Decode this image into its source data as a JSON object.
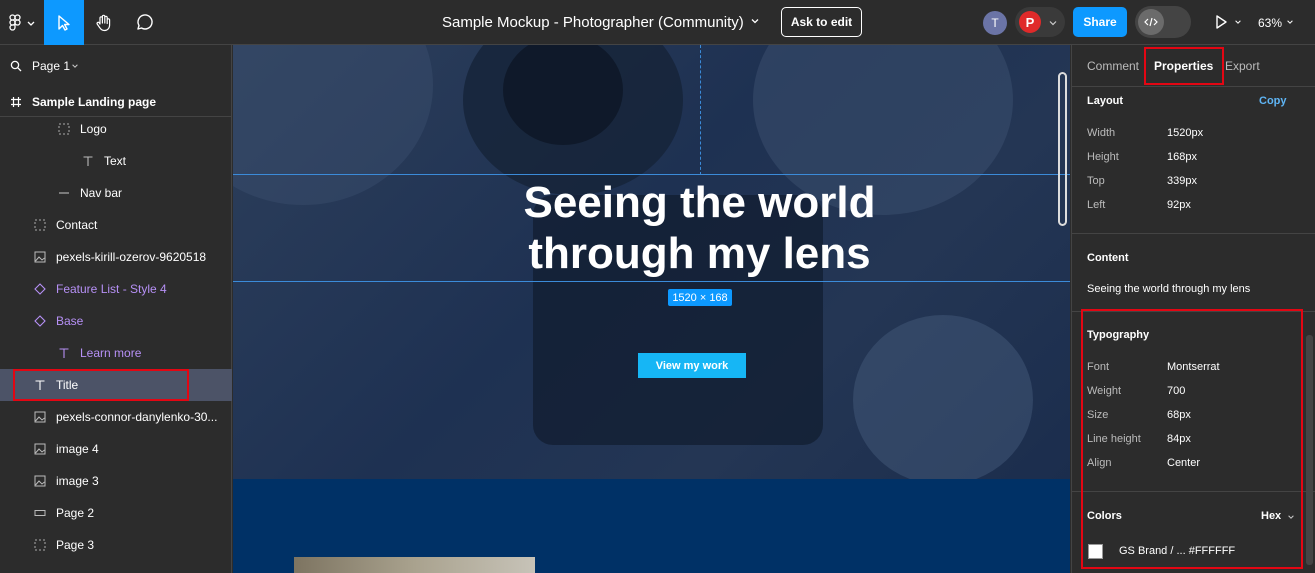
{
  "topbar": {
    "file_title": "Sample Mockup - Photographer (Community)",
    "ask_to_edit_label": "Ask to edit",
    "avatar_initial": "T",
    "share_label": "Share",
    "zoom_level": "63%"
  },
  "left_panel": {
    "page_label": "Page 1",
    "frame_label": "Sample Landing page",
    "layers": [
      {
        "label": "Logo",
        "icon": "frame-icon"
      },
      {
        "label": "Text",
        "icon": "text-icon"
      },
      {
        "label": "Nav bar",
        "icon": "line-icon"
      },
      {
        "label": "Contact",
        "icon": "frame-icon"
      },
      {
        "label": "pexels-kirill-ozerov-9620518",
        "icon": "image-icon"
      },
      {
        "label": "Feature List - Style 4",
        "icon": "component-instance-icon"
      },
      {
        "label": "Base",
        "icon": "component-instance-icon"
      },
      {
        "label": "Learn more",
        "icon": "text-icon"
      },
      {
        "label": "Title",
        "icon": "text-icon"
      },
      {
        "label": "pexels-connor-danylenko-30...",
        "icon": "image-icon"
      },
      {
        "label": "image 4",
        "icon": "image-icon"
      },
      {
        "label": "image 3",
        "icon": "image-icon"
      },
      {
        "label": "Page 2",
        "icon": "rectangle-icon"
      },
      {
        "label": "Page 3",
        "icon": "frame-icon"
      }
    ]
  },
  "canvas": {
    "hero_title_line1": "Seeing the world",
    "hero_title_line2": "through my lens",
    "dimension_badge": "1520 × 168",
    "cta_label": "View my work"
  },
  "right_panel": {
    "tabs": [
      "Comment",
      "Properties",
      "Export"
    ],
    "layout_heading": "Layout",
    "copy_label": "Copy",
    "layout": [
      {
        "key": "Width",
        "value": "1520px"
      },
      {
        "key": "Height",
        "value": "168px"
      },
      {
        "key": "Top",
        "value": "339px"
      },
      {
        "key": "Left",
        "value": "92px"
      }
    ],
    "content_heading": "Content",
    "content_text": "Seeing the world through my lens",
    "typography_heading": "Typography",
    "typography": [
      {
        "key": "Font",
        "value": "Montserrat"
      },
      {
        "key": "Weight",
        "value": "700"
      },
      {
        "key": "Size",
        "value": "68px"
      },
      {
        "key": "Line height",
        "value": "84px"
      },
      {
        "key": "Align",
        "value": "Center"
      }
    ],
    "colors_heading": "Colors",
    "color_format": "Hex",
    "color_swatch": {
      "name": "GS Brand / ...",
      "hex": "#FFFFFF"
    }
  }
}
